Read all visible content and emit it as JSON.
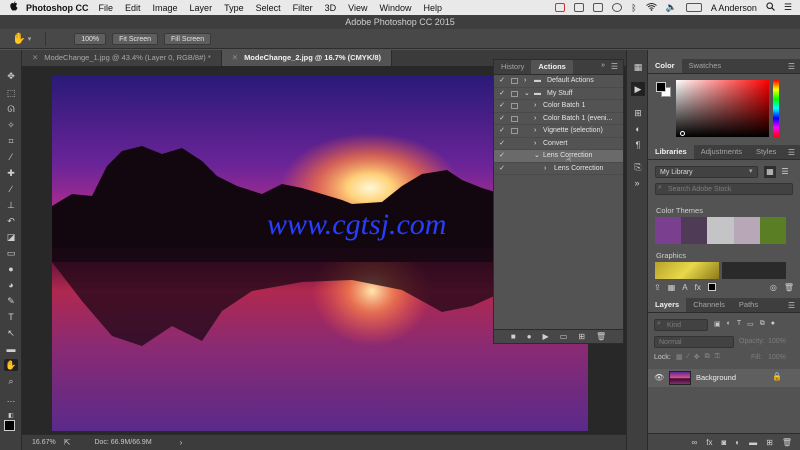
{
  "menubar": {
    "apple": "",
    "app_name": "Photoshop CC",
    "items": [
      "File",
      "Edit",
      "Image",
      "Layer",
      "Type",
      "Select",
      "Filter",
      "3D",
      "View",
      "Window",
      "Help"
    ],
    "user": "A Anderson"
  },
  "window": {
    "title": "Adobe Photoshop CC 2015"
  },
  "options_bar": {
    "zoom_btn": "100%",
    "fit_screen": "Fit Screen",
    "fill_screen": "Fill Screen"
  },
  "tabs": [
    {
      "label": "ModeChange_1.jpg @ 43.4% (Layer 0, RGB/8#) *",
      "active": false
    },
    {
      "label": "ModeChange_2.jpg @ 16.7% (CMYK/8)",
      "active": true
    }
  ],
  "status": {
    "zoom": "16.67%",
    "doc": "Doc: 66.9M/66.9M"
  },
  "watermark": "www.cgtsj.com",
  "actions_panel": {
    "tabs": [
      "History",
      "Actions"
    ],
    "rows": [
      {
        "label": "Default Actions",
        "type": "set",
        "check": "✓",
        "dialog": true,
        "expanded": false
      },
      {
        "label": "My Stuff",
        "type": "set",
        "check": "✓",
        "dialog": true,
        "expanded": true
      },
      {
        "label": "Color Batch 1",
        "type": "action",
        "check": "✓",
        "dialog": true
      },
      {
        "label": "Color Batch 1 (eveni...",
        "type": "action",
        "check": "✓",
        "dialog": true
      },
      {
        "label": "Vignette (selection)",
        "type": "action",
        "check": "✓",
        "dialog": true
      },
      {
        "label": "Convert",
        "type": "action",
        "check": "✓",
        "dialog": false
      },
      {
        "label": "Lens Correction",
        "type": "action",
        "check": "✓",
        "dialog": false,
        "expanded": true,
        "selected": true
      },
      {
        "label": "Lens Correction",
        "type": "step",
        "check": "✓",
        "dialog": false
      }
    ]
  },
  "color_panel": {
    "tabs": [
      "Color",
      "Swatches"
    ],
    "fg": "#000000",
    "bg": "#ffffff",
    "hue_color": "#ff0000"
  },
  "libraries_panel": {
    "tabs": [
      "Libraries",
      "Adjustments",
      "Styles"
    ],
    "library": "My Library",
    "search_placeholder": "Search Adobe Stock",
    "color_themes_label": "Color Themes",
    "theme_colors": [
      "#7a3f8f",
      "#4f3b55",
      "#c4c3c6",
      "#b8a7b7",
      "#5a7e23"
    ],
    "graphics_label": "Graphics"
  },
  "layers_panel": {
    "tabs": [
      "Layers",
      "Channels",
      "Paths"
    ],
    "kind": "Kind",
    "blend": "Normal",
    "opacity_label": "Opacity:",
    "opacity": "100%",
    "lock_label": "Lock:",
    "fill_label": "Fill:",
    "fill": "100%",
    "layer_name": "Background"
  }
}
